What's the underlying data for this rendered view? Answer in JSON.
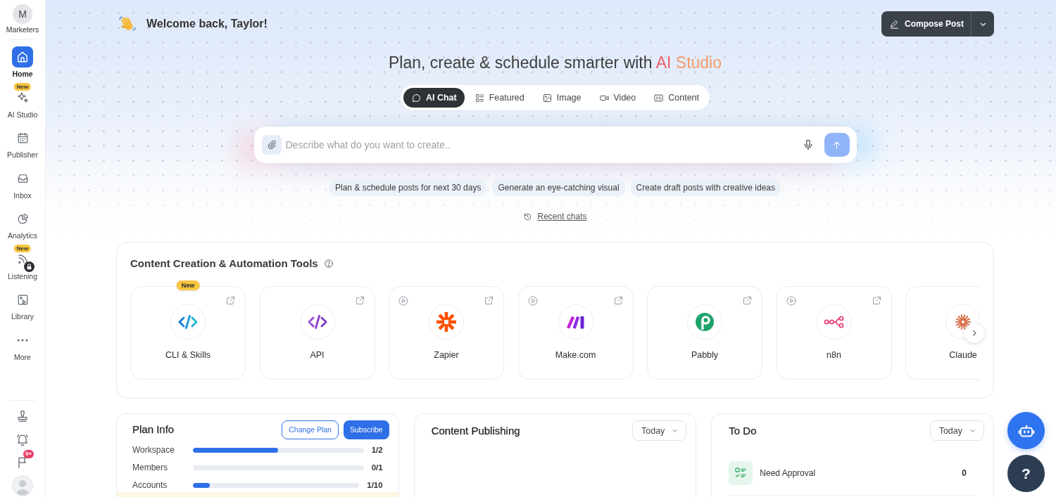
{
  "sidebar": {
    "workspace": {
      "initial": "M",
      "name": "Marketers"
    },
    "items": [
      {
        "label": "Home",
        "selected": true,
        "locked": false
      },
      {
        "label": "AI Studio",
        "badge": "New",
        "selected": false,
        "locked": false
      },
      {
        "label": "Publisher",
        "selected": false,
        "locked": false
      },
      {
        "label": "Inbox",
        "selected": false,
        "locked": false
      },
      {
        "label": "Analytics",
        "selected": false,
        "locked": false
      },
      {
        "label": "Listening",
        "badge": "New",
        "selected": false,
        "locked": true
      },
      {
        "label": "Library",
        "selected": false,
        "locked": false
      },
      {
        "label": "More",
        "selected": false,
        "locked": false
      }
    ],
    "flag_badge": "9+"
  },
  "header": {
    "greeting": "Welcome back, Taylor!",
    "compose_button": "Compose Post"
  },
  "hero": {
    "title": "Plan, create & schedule smarter with",
    "title_highlight": "AI Studio",
    "modes": [
      {
        "label": "AI Chat",
        "selected": true
      },
      {
        "label": "Featured",
        "selected": false
      },
      {
        "label": "Image",
        "selected": false
      },
      {
        "label": "Video",
        "selected": false
      },
      {
        "label": "Content",
        "selected": false
      }
    ],
    "prompt": {
      "placeholder": "Describe what do you want to create..",
      "send_disabled": true
    },
    "suggestions": [
      "Plan & schedule posts for next 30 days",
      "Generate an eye-catching visual",
      "Create draft posts with creative ideas"
    ],
    "recent_link": "Recent chats"
  },
  "tools": {
    "title": "Content Creation & Automation Tools",
    "items": [
      {
        "name": "CLI & Skills",
        "badge": "New",
        "video": false,
        "external": true
      },
      {
        "name": "API",
        "video": false,
        "external": true
      },
      {
        "name": "Zapier",
        "video": true,
        "external": true
      },
      {
        "name": "Make.com",
        "video": true,
        "external": true
      },
      {
        "name": "Pabbly",
        "video": false,
        "external": true
      },
      {
        "name": "n8n",
        "video": true,
        "external": true
      },
      {
        "name": "Claude",
        "video": false,
        "external": false
      }
    ]
  },
  "plan_info": {
    "title": "Plan Info",
    "buttons": [
      {
        "label": "Change Plan",
        "kind": "outline"
      },
      {
        "label": "Subscribe",
        "kind": "primary"
      }
    ],
    "usage": [
      {
        "label": "Workspace",
        "level": 0.5,
        "reading": "1/2"
      },
      {
        "label": "Members",
        "level": 0,
        "reading": "0/1"
      },
      {
        "label": "Accounts",
        "level": 0.1,
        "reading": "1/10"
      }
    ]
  },
  "content_publishing": {
    "title": "Content Publishing",
    "period": "Today"
  },
  "todo": {
    "title": "To Do",
    "period": "Today",
    "items": [
      {
        "label": "Need Approval",
        "count": "0"
      }
    ]
  },
  "help_button": "?"
}
